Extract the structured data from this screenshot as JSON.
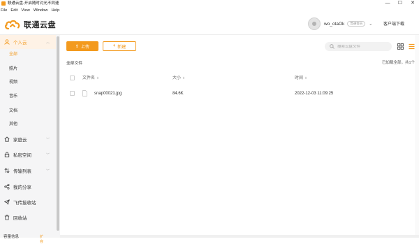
{
  "window": {
    "title": "联通云盘-开启随时对光不同速",
    "controls": [
      "—",
      "☐",
      "✕"
    ]
  },
  "menubar": [
    "File",
    "Edit",
    "View",
    "Window",
    "Help"
  ],
  "header": {
    "brand": "联通云盘",
    "username": "wo_otaOk",
    "vip_badge": "普通会员",
    "client_download": "客户端下载"
  },
  "sidebar": {
    "personal": {
      "label": "个人云",
      "subitems": [
        "全部",
        "照片",
        "视频",
        "音乐",
        "文档",
        "其他"
      ]
    },
    "items": [
      {
        "label": "家庭云",
        "expandable": true
      },
      {
        "label": "私密空间",
        "expandable": true
      },
      {
        "label": "传输列表",
        "expandable": true
      },
      {
        "label": "我的分享",
        "expandable": false
      },
      {
        "label": "飞传接收站",
        "expandable": false
      },
      {
        "label": "回收站",
        "expandable": false
      }
    ],
    "quota": {
      "label": "容量信息",
      "link": "扩容"
    }
  },
  "toolbar": {
    "upload_label": "上传",
    "new_label": "新建",
    "search_placeholder": "搜索云盘文件"
  },
  "breadcrumb": "全部文件",
  "loaded_status": "已加载全部，共1个",
  "table": {
    "columns": [
      "文件名",
      "大小",
      "时间"
    ],
    "rows": [
      {
        "name": "snap00021.jpg",
        "size": "84.6K",
        "time": "2022-12-03 11:09:25"
      }
    ]
  },
  "colors": {
    "accent": "#f39a1e",
    "active_bg": "#fef2e6",
    "sidebar_bg": "#f5f5f6"
  }
}
